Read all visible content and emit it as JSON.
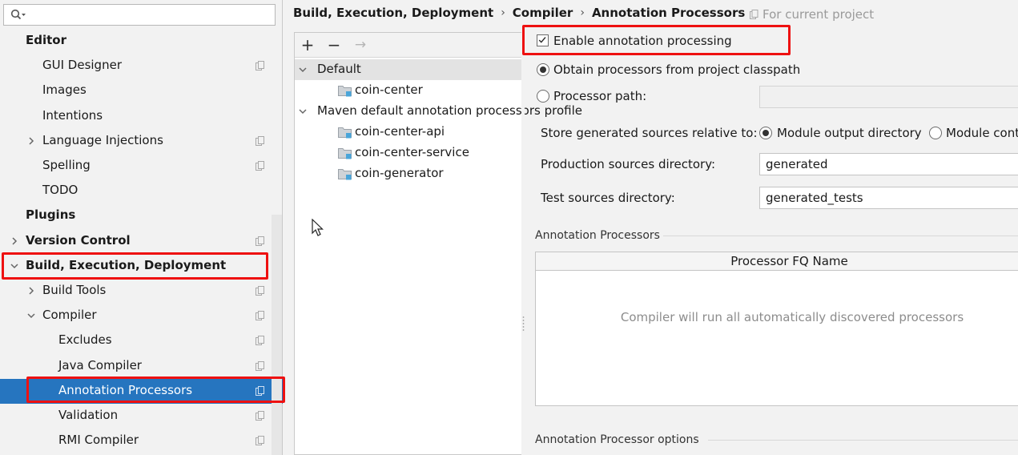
{
  "search": {
    "placeholder": ""
  },
  "tree": {
    "items": [
      {
        "label": "Editor",
        "level": 0,
        "bold": true,
        "chevron": "none",
        "scope": false
      },
      {
        "label": "GUI Designer",
        "level": 1,
        "bold": false,
        "chevron": "none",
        "scope": true
      },
      {
        "label": "Images",
        "level": 1,
        "bold": false,
        "chevron": "none",
        "scope": false
      },
      {
        "label": "Intentions",
        "level": 1,
        "bold": false,
        "chevron": "none",
        "scope": false
      },
      {
        "label": "Language Injections",
        "level": 1,
        "bold": false,
        "chevron": "right",
        "scope": true
      },
      {
        "label": "Spelling",
        "level": 1,
        "bold": false,
        "chevron": "none",
        "scope": true
      },
      {
        "label": "TODO",
        "level": 1,
        "bold": false,
        "chevron": "none",
        "scope": false
      },
      {
        "label": "Plugins",
        "level": 0,
        "bold": true,
        "chevron": "none",
        "scope": false
      },
      {
        "label": "Version Control",
        "level": 0,
        "bold": true,
        "chevron": "right",
        "scope": true
      },
      {
        "label": "Build, Execution, Deployment",
        "level": 0,
        "bold": true,
        "chevron": "down",
        "scope": false
      },
      {
        "label": "Build Tools",
        "level": 1,
        "bold": false,
        "chevron": "right",
        "scope": true
      },
      {
        "label": "Compiler",
        "level": 1,
        "bold": false,
        "chevron": "down",
        "scope": true
      },
      {
        "label": "Excludes",
        "level": 2,
        "bold": false,
        "chevron": "none",
        "scope": true
      },
      {
        "label": "Java Compiler",
        "level": 2,
        "bold": false,
        "chevron": "none",
        "scope": true
      },
      {
        "label": "Annotation Processors",
        "level": 2,
        "bold": false,
        "chevron": "none",
        "scope": true,
        "selected": true
      },
      {
        "label": "Validation",
        "level": 2,
        "bold": false,
        "chevron": "none",
        "scope": true
      },
      {
        "label": "RMI Compiler",
        "level": 2,
        "bold": false,
        "chevron": "none",
        "scope": true
      }
    ]
  },
  "breadcrumb": {
    "parts": [
      "Build, Execution, Deployment",
      "Compiler",
      "Annotation Processors"
    ],
    "separator": "›",
    "scope_note": "For current project"
  },
  "profiles": {
    "toolbar": {
      "add": "+",
      "remove": "−",
      "move": "→"
    },
    "rows": [
      {
        "type": "group",
        "label": "Default",
        "expanded": true
      },
      {
        "type": "module",
        "label": "coin-center"
      },
      {
        "type": "group",
        "label": "Maven default annotation processors profile",
        "expanded": true
      },
      {
        "type": "module",
        "label": "coin-center-api"
      },
      {
        "type": "module",
        "label": "coin-center-service"
      },
      {
        "type": "module",
        "label": "coin-generator"
      }
    ]
  },
  "options": {
    "enable_processing": {
      "label": "Enable annotation processing",
      "checked": true
    },
    "obtain_classpath": {
      "label": "Obtain processors from project classpath",
      "selected": true
    },
    "processor_path": {
      "label": "Processor path:",
      "selected": false,
      "value": ""
    },
    "store_relative": {
      "label": "Store generated sources relative to:",
      "opt_output": "Module output directory",
      "opt_content": "Module content root",
      "selected": "output"
    },
    "production_dir": {
      "label": "Production sources directory:",
      "value": "generated"
    },
    "test_dir": {
      "label": "Test sources directory:",
      "value": "generated_tests"
    },
    "processors_section": "Annotation Processors",
    "processors_header": "Processor FQ Name",
    "processors_empty": "Compiler will run all automatically discovered processors",
    "options_section": "Annotation Processor options"
  },
  "colors": {
    "selection": "#2675bf",
    "highlight": "#ee1111",
    "module_icon": "#4aa5d9"
  }
}
